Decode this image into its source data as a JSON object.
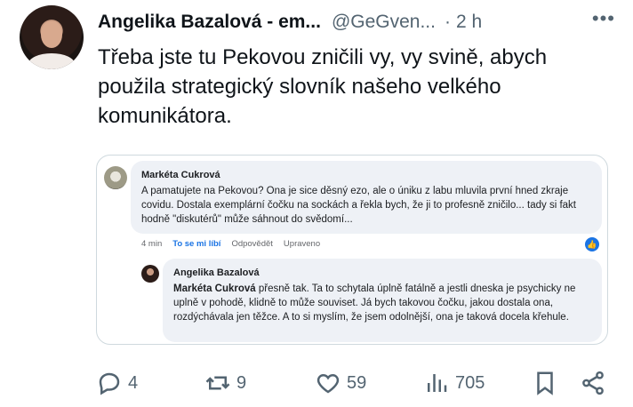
{
  "tweet": {
    "author_name": "Angelika Bazalová - em...",
    "handle": "@GeGven...",
    "separator": "·",
    "time": "2 h",
    "more": "•••",
    "text": "Třeba jste tu Pekovou zničili vy, vy svině, abych použila strategický slovník našeho velkého komunikátora."
  },
  "embedded_screenshot": {
    "comment1": {
      "author": "Markéta Cukrová",
      "text": "A pamatujete na Pekovou? Ona je sice děsný ezo, ale o úniku z labu mluvila první hned zkraje covidu. Dostala exemplární čočku na sockách a řekla bych, že ji to profesně zničilo... tady si fakt hodně \"diskutérů\" může sáhnout do svědomí...",
      "time": "4 min",
      "like_label": "To se mi líbí",
      "reply_label": "Odpovědět",
      "edited_label": "Upraveno"
    },
    "comment2": {
      "author": "Angelika Bazalová",
      "mention": "Markéta Cukrová",
      "text": " přesně tak. Ta to schytala úplně fatálně a jestli dneska je psychicky ne uplně v pohodě, klidně to může souviset. Já bych takovou čočku, jakou dostala ona, rozdýchávala jen těžce. A to si myslím, že jsem odolnější, ona je taková docela křehule."
    }
  },
  "actions": {
    "replies": "4",
    "reposts": "9",
    "likes": "59",
    "views": "705"
  },
  "icons": [
    "reply-icon",
    "repost-icon",
    "like-icon",
    "views-icon",
    "bookmark-icon",
    "share-icon"
  ]
}
